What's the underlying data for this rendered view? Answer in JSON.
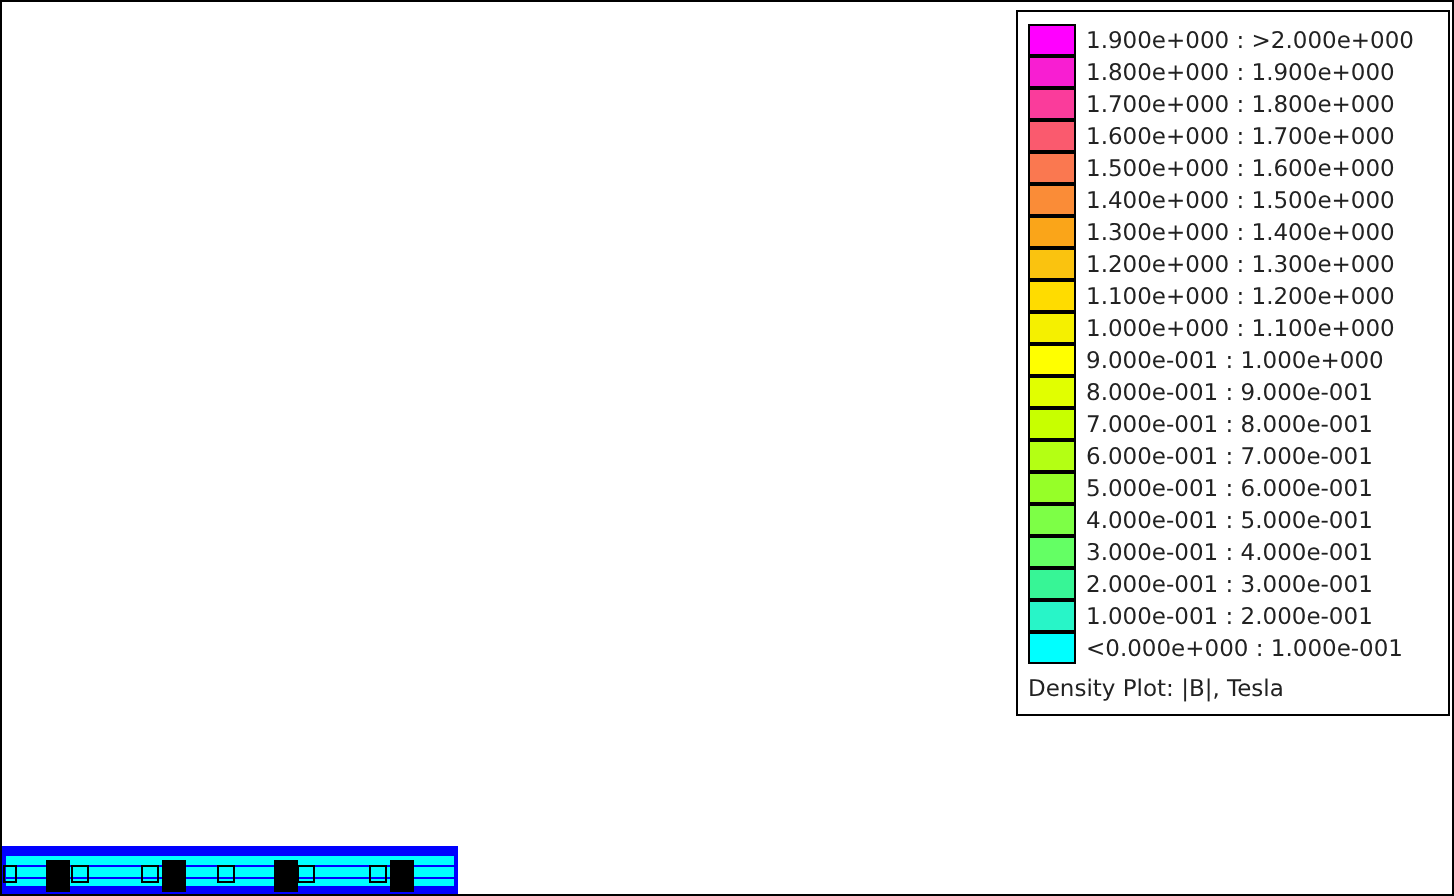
{
  "legend": {
    "rows": [
      {
        "label": "1.900e+000 : >2.000e+000",
        "color": "#ff00ff"
      },
      {
        "label": "1.800e+000 : 1.900e+000",
        "color": "#f81ed2"
      },
      {
        "label": "1.700e+000 : 1.800e+000",
        "color": "#fa3c9b"
      },
      {
        "label": "1.600e+000 : 1.700e+000",
        "color": "#fa5a6e"
      },
      {
        "label": "1.500e+000 : 1.600e+000",
        "color": "#fa7850"
      },
      {
        "label": "1.400e+000 : 1.500e+000",
        "color": "#fa8c37"
      },
      {
        "label": "1.300e+000 : 1.400e+000",
        "color": "#faa519"
      },
      {
        "label": "1.200e+000 : 1.300e+000",
        "color": "#fac30f"
      },
      {
        "label": "1.100e+000 : 1.200e+000",
        "color": "#ffdc00"
      },
      {
        "label": "1.000e+000 : 1.100e+000",
        "color": "#f5f000"
      },
      {
        "label": "9.000e-001 : 1.000e+000",
        "color": "#ffff00"
      },
      {
        "label": "8.000e-001 : 9.000e-001",
        "color": "#e1ff00"
      },
      {
        "label": "7.000e-001 : 8.000e-001",
        "color": "#c8ff00"
      },
      {
        "label": "6.000e-001 : 7.000e-001",
        "color": "#b4ff14"
      },
      {
        "label": "5.000e-001 : 6.000e-001",
        "color": "#96ff28"
      },
      {
        "label": "4.000e-001 : 5.000e-001",
        "color": "#7dff46"
      },
      {
        "label": "3.000e-001 : 4.000e-001",
        "color": "#64ff64"
      },
      {
        "label": "2.000e-001 : 3.000e-001",
        "color": "#37f596"
      },
      {
        "label": "1.000e-001 : 2.000e-001",
        "color": "#28f5c8"
      },
      {
        "label": "<0.000e+000 : 1.000e-001",
        "color": "#00ffff"
      }
    ],
    "caption": "Density Plot: |B|, Tesla"
  }
}
